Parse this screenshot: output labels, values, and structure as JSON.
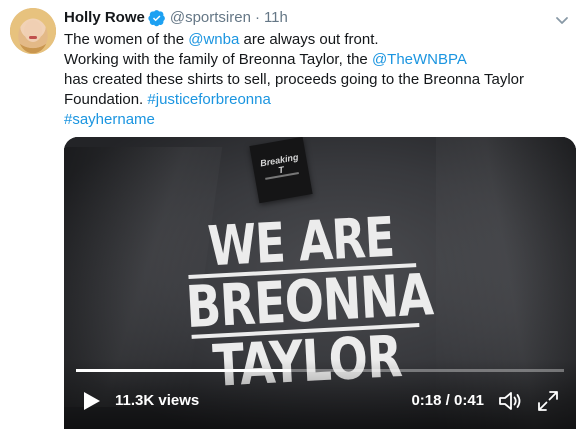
{
  "tweet": {
    "author_name": "Holly Rowe",
    "handle": "@sportsiren",
    "separator": "·",
    "time": "11h",
    "lines": [
      [
        {
          "t": "The women of the "
        },
        {
          "t": "@wnba",
          "link": true
        },
        {
          "t": " are always out front."
        }
      ],
      [
        {
          "t": "Working with the family of Breonna Taylor, the "
        },
        {
          "t": "@TheWNBPA",
          "link": true
        }
      ],
      [
        {
          "t": "has created these shirts to sell, proceeds going to the Breonna Taylor"
        }
      ],
      [
        {
          "t": "Foundation. "
        },
        {
          "t": "#justiceforbreonna",
          "link": true
        }
      ],
      [
        {
          "t": "#sayhername",
          "link": true
        }
      ]
    ]
  },
  "media": {
    "tag_text": "Breaking T",
    "slogan": [
      "WE ARE",
      "BREONNA",
      "TAYLOR"
    ],
    "views": "11.3K views",
    "timecode": "0:18 / 0:41",
    "progress": 0.44
  },
  "icons": {
    "verified": "verified-badge-icon",
    "caret": "chevron-down-icon",
    "play": "play-icon",
    "volume": "volume-icon",
    "fullscreen": "fullscreen-icon"
  },
  "colors": {
    "link": "#1b95e0",
    "verified": "#1da1f2",
    "secondary_text": "#657786"
  }
}
